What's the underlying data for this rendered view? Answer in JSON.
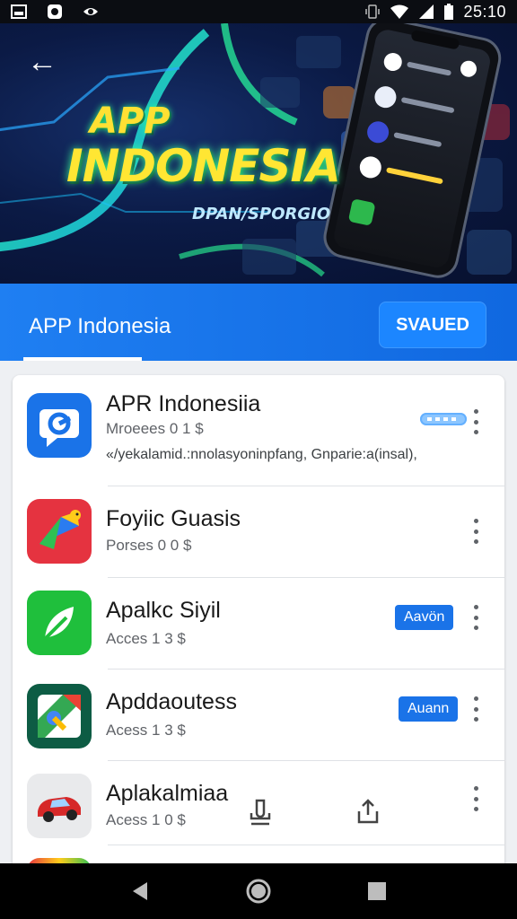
{
  "status_bar": {
    "time": "25:10",
    "left_icons": [
      "photo-icon",
      "square-app-icon",
      "eye-icon"
    ],
    "right_icons": [
      "vibrate-icon",
      "wifi-icon",
      "signal-icon",
      "battery-icon"
    ]
  },
  "hero": {
    "back_icon": "back-arrow-icon",
    "title_line1": "APP",
    "title_line2": "INDONESIA",
    "subtitle": "DPAN/SPORGIO"
  },
  "tab_header": {
    "active_tab": "APP Indonesia",
    "saved_button": "SVAUED"
  },
  "apps": [
    {
      "name": "APR Indonesiia",
      "meta": "Mroeees 0 1 $",
      "description": "«/yekalamid.:nnolasyoninpfang, Gnparie:a(insal),",
      "icon": "blue-chat-icon",
      "action": "",
      "pill": true
    },
    {
      "name": "Foyiic Guasis",
      "meta": "Porses 0 0 $",
      "icon": "colorful-bird-icon",
      "action": ""
    },
    {
      "name": "Apalkc Siyil",
      "meta": "Acces 1 3 $",
      "icon": "green-leaf-icon",
      "action": "Aavön"
    },
    {
      "name": "Apddaoutess",
      "meta": "Acess 1 3 $",
      "icon": "google-maps-icon",
      "action": "Auann"
    },
    {
      "name": "Aplakalmiaa",
      "meta": "Acess 1 0 $",
      "icon": "red-car-icon",
      "action": ""
    }
  ],
  "colors": {
    "tab_blue": "#1a73e8",
    "action_blue": "#1a73e8",
    "hero_title_yellow": "#ffe033"
  },
  "nav_bar": {
    "buttons": [
      "back-triangle-icon",
      "home-circle-icon",
      "recents-square-icon"
    ]
  }
}
